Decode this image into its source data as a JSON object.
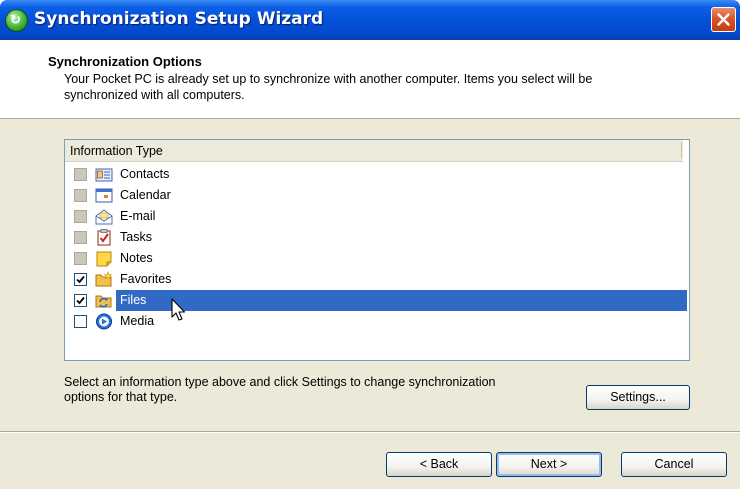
{
  "window": {
    "title": "Synchronization Setup Wizard"
  },
  "header": {
    "title": "Synchronization Options",
    "description": "Your Pocket PC is already set up to synchronize with another computer. Items you select will be synchronized with all computers."
  },
  "list": {
    "column_header": "Information Type",
    "items": [
      {
        "label": "Contacts",
        "checked": false,
        "enabled": false,
        "icon": "contacts-icon"
      },
      {
        "label": "Calendar",
        "checked": false,
        "enabled": false,
        "icon": "calendar-icon"
      },
      {
        "label": "E-mail",
        "checked": false,
        "enabled": false,
        "icon": "email-icon"
      },
      {
        "label": "Tasks",
        "checked": false,
        "enabled": false,
        "icon": "tasks-icon"
      },
      {
        "label": "Notes",
        "checked": false,
        "enabled": false,
        "icon": "notes-icon"
      },
      {
        "label": "Favorites",
        "checked": true,
        "enabled": true,
        "icon": "favorites-icon"
      },
      {
        "label": "Files",
        "checked": true,
        "enabled": true,
        "icon": "files-icon",
        "selected": true
      },
      {
        "label": "Media",
        "checked": false,
        "enabled": true,
        "icon": "media-icon"
      }
    ]
  },
  "info_text": "Select an information type above and click Settings to change synchronization options for that type.",
  "buttons": {
    "settings": "Settings...",
    "back": "< Back",
    "next": "Next >",
    "cancel": "Cancel"
  },
  "colors": {
    "titlebar": "#0451d8",
    "selection": "#316ac5",
    "dialog_bg": "#ece9d8"
  }
}
